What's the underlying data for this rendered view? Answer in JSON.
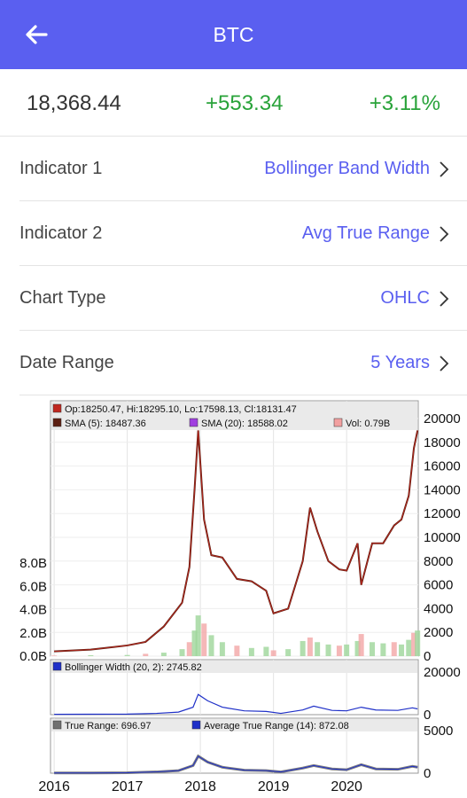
{
  "header": {
    "title": "BTC"
  },
  "quote": {
    "price": "18,368.44",
    "change": "+553.34",
    "percent": "+3.11%"
  },
  "settings": [
    {
      "label": "Indicator 1",
      "value": "Bollinger Band Width"
    },
    {
      "label": "Indicator 2",
      "value": "Avg True Range"
    },
    {
      "label": "Chart Type",
      "value": "OHLC"
    },
    {
      "label": "Date Range",
      "value": "5 Years"
    }
  ],
  "colors": {
    "accent": "#5a5ff0",
    "positive": "#29a33a",
    "appbar": "#5a5ff0"
  },
  "icons": {
    "back": "arrow-left-icon",
    "chevron": "chevron-right-icon"
  },
  "chart_data": [
    {
      "type": "line",
      "panel": "price",
      "legend": [
        {
          "color": "#c0271f",
          "text": "Op:18250.47, Hi:18295.10, Lo:17598.13, Cl:18131.47"
        },
        {
          "color": "#5c1f12",
          "text": "SMA (5): 18487.36"
        },
        {
          "color": "#a040e0",
          "text": "SMA (20): 18588.02"
        },
        {
          "color": "#f2a0a0",
          "text": "Vol: 0.79B"
        }
      ],
      "y_ticks": [
        "20000",
        "18000",
        "16000",
        "14000",
        "12000",
        "10000",
        "8000",
        "6000",
        "4000",
        "2000",
        "0"
      ],
      "ylim": [
        0,
        20000
      ],
      "volume_ticks": [
        "8.0B",
        "6.0B",
        "4.0B",
        "2.0B",
        "0.0B"
      ],
      "volume_lim": [
        0,
        8
      ],
      "x": [
        2016.0,
        2016.5,
        2017.0,
        2017.25,
        2017.5,
        2017.75,
        2017.85,
        2017.92,
        2017.97,
        2018.05,
        2018.15,
        2018.3,
        2018.5,
        2018.7,
        2018.9,
        2019.0,
        2019.2,
        2019.4,
        2019.5,
        2019.6,
        2019.75,
        2019.9,
        2020.0,
        2020.15,
        2020.2,
        2020.35,
        2020.5,
        2020.65,
        2020.75,
        2020.85,
        2020.92,
        2020.97
      ],
      "values": [
        400,
        550,
        900,
        1200,
        2500,
        4500,
        7500,
        14000,
        19000,
        11500,
        8500,
        8300,
        6500,
        6300,
        5500,
        3600,
        4000,
        8000,
        12500,
        10500,
        8000,
        7300,
        7200,
        9500,
        6000,
        9500,
        9500,
        11000,
        11500,
        13500,
        17500,
        19000
      ],
      "volume": [
        0.05,
        0.08,
        0.1,
        0.2,
        0.3,
        0.6,
        1.2,
        2.2,
        3.5,
        2.8,
        1.8,
        1.2,
        0.9,
        0.7,
        0.8,
        0.5,
        0.6,
        1.3,
        1.6,
        1.2,
        1.0,
        0.9,
        1.0,
        1.3,
        1.9,
        1.2,
        1.1,
        1.2,
        1.0,
        1.4,
        2.0,
        2.2
      ]
    },
    {
      "type": "line",
      "panel": "bollinger",
      "legend": [
        {
          "color": "#1f30c8",
          "text": "Bollinger Width (20, 2): 2745.82"
        }
      ],
      "y_ticks": [
        "20000",
        "0"
      ],
      "ylim": [
        0,
        20000
      ],
      "x": [
        2016.0,
        2016.5,
        2017.0,
        2017.4,
        2017.7,
        2017.9,
        2017.97,
        2018.1,
        2018.3,
        2018.6,
        2018.9,
        2019.1,
        2019.4,
        2019.55,
        2019.8,
        2020.0,
        2020.2,
        2020.4,
        2020.7,
        2020.9,
        2020.97
      ],
      "values": [
        150,
        200,
        250,
        600,
        1200,
        3500,
        9500,
        6500,
        3500,
        1800,
        1500,
        600,
        2200,
        4000,
        2000,
        1800,
        3500,
        2200,
        2000,
        3200,
        2700
      ]
    },
    {
      "type": "line",
      "panel": "atr",
      "legend": [
        {
          "color": "#707070",
          "text": "True Range: 696.97"
        },
        {
          "color": "#1f30c8",
          "text": "Average True Range (14): 872.08"
        }
      ],
      "y_ticks": [
        "5000",
        "0"
      ],
      "ylim": [
        0,
        5000
      ],
      "x_ticks": [
        "2016",
        "2017",
        "2018",
        "2019",
        "2020"
      ],
      "x": [
        2016.0,
        2016.5,
        2017.0,
        2017.4,
        2017.7,
        2017.9,
        2017.97,
        2018.1,
        2018.3,
        2018.6,
        2018.9,
        2019.1,
        2019.4,
        2019.55,
        2019.8,
        2020.0,
        2020.2,
        2020.4,
        2020.7,
        2020.9,
        2020.97
      ],
      "values": [
        20,
        30,
        50,
        150,
        300,
        900,
        2000,
        1300,
        700,
        350,
        300,
        150,
        600,
        900,
        500,
        400,
        1000,
        500,
        450,
        800,
        700
      ]
    }
  ]
}
